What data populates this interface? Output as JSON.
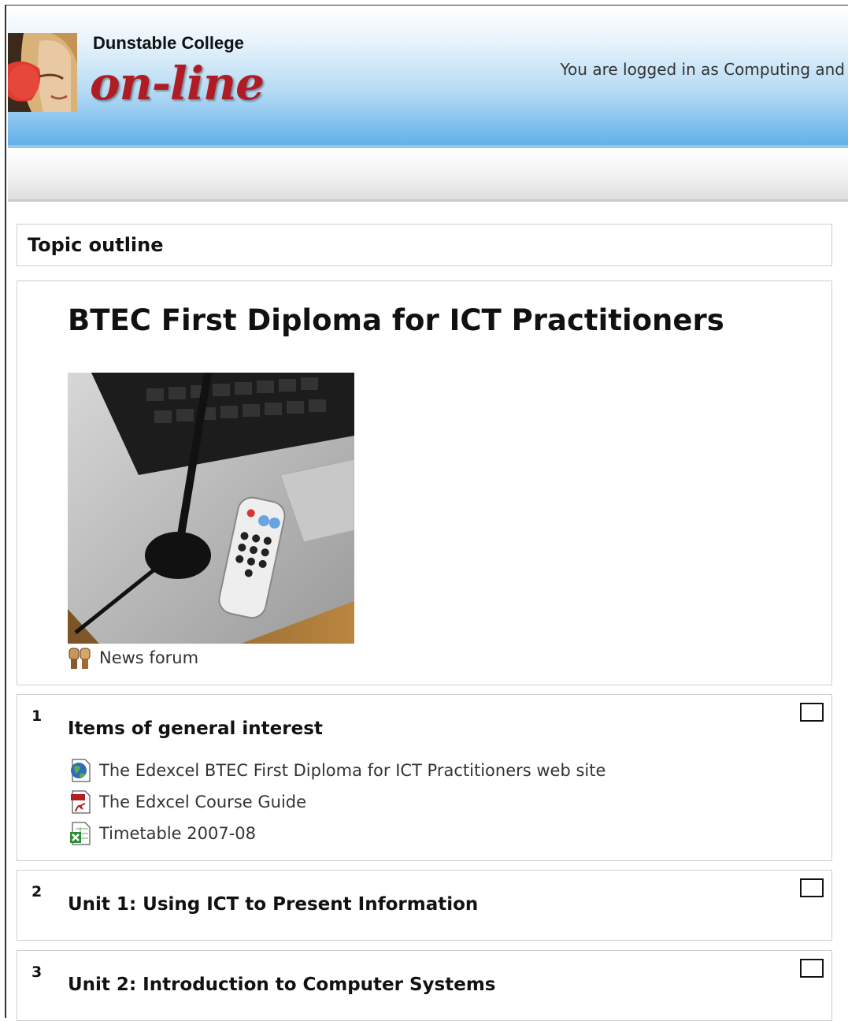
{
  "header": {
    "college_name": "Dunstable College",
    "brand": "on-line",
    "login_prefix": "You are logged in as",
    "login_user": "Computing and"
  },
  "topic_outline": {
    "label": "Topic outline"
  },
  "section0": {
    "course_title": "BTEC First Diploma for ICT Practitioners",
    "activities": [
      {
        "label": "News forum",
        "icon": "forum-icon"
      }
    ]
  },
  "sections": [
    {
      "number": "1",
      "title": "Items of general interest",
      "activities": [
        {
          "label": "The Edexcel BTEC First Diploma for ICT Practitioners web site",
          "icon": "web-link-icon"
        },
        {
          "label": "The Edxcel Course Guide",
          "icon": "pdf-icon"
        },
        {
          "label": "Timetable 2007-08",
          "icon": "spreadsheet-icon"
        }
      ]
    },
    {
      "number": "2",
      "title": "Unit 1: Using ICT to Present Information",
      "activities": []
    },
    {
      "number": "3",
      "title": "Unit 2: Introduction to Computer Systems",
      "activities": []
    }
  ],
  "colors": {
    "brand_red": "#b01c24",
    "header_blue": "#5fb0ea",
    "border": "#cfcfcf"
  }
}
